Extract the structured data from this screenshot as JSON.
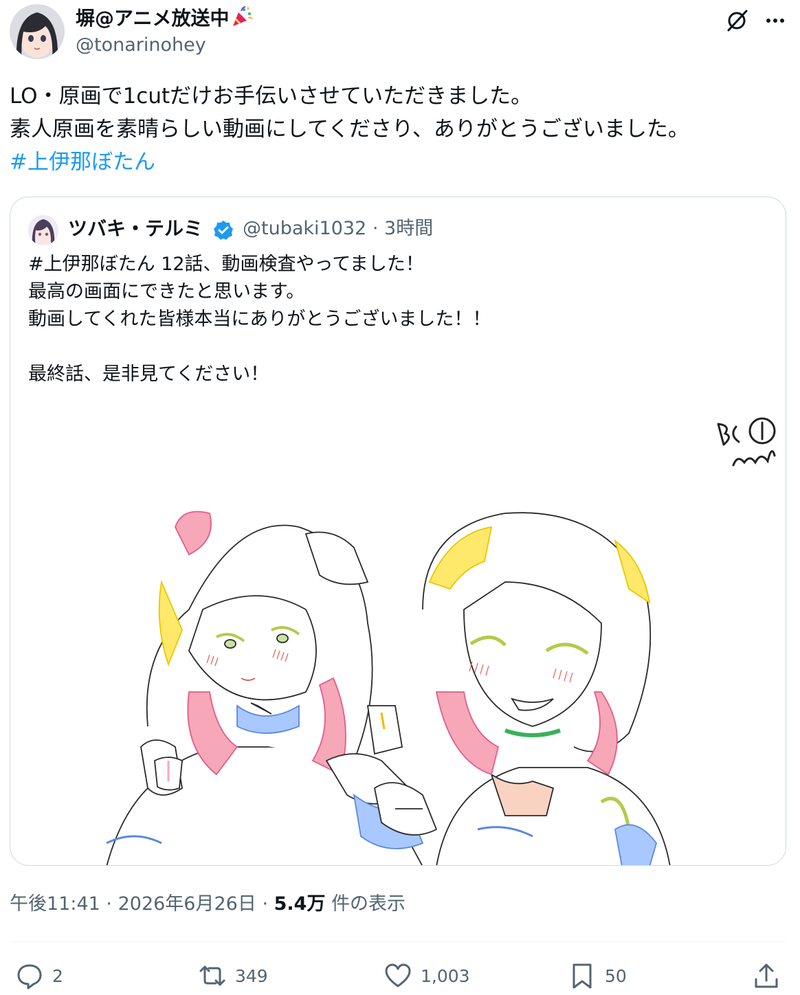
{
  "author": {
    "display_name": "塀@アニメ放送中",
    "emoji_icon": "party-popper-icon",
    "handle": "@tonarinohey"
  },
  "tweet": {
    "lines": [
      "LO・原画で1cutだけお手伝いさせていただきました。",
      "素人原画を素晴らしい動画にしてくださり、ありがとうございました。"
    ],
    "hashtag": "#上伊那ぼたん"
  },
  "quote": {
    "display_name": "ツバキ・テルミ",
    "verified": true,
    "handle": "@tubaki1032",
    "separator": "·",
    "time": "3時間",
    "lines": [
      "#上伊那ぼたん 12話、動画検査やってました！",
      "最高の画面にできたと思います。",
      "動画してくれた皆様本当にありがとうございました！！",
      "",
      "最終話、是非見てください！"
    ],
    "image": {
      "description": "Two anime girls line-art illustration with colored trace lines",
      "corner_mark": "B1 end"
    }
  },
  "meta": {
    "time": "午後11:41",
    "date": "2026年6月26日",
    "views_value": "5.4万",
    "views_label": "件の表示",
    "separator": "·"
  },
  "actions": {
    "reply_count": "2",
    "retweet_count": "349",
    "like_count": "1,003",
    "bookmark_count": "50"
  },
  "colors": {
    "link": "#1d9bf0",
    "secondary_text": "#536471",
    "border": "#cfd9de",
    "verified": "#1d9bf0"
  }
}
